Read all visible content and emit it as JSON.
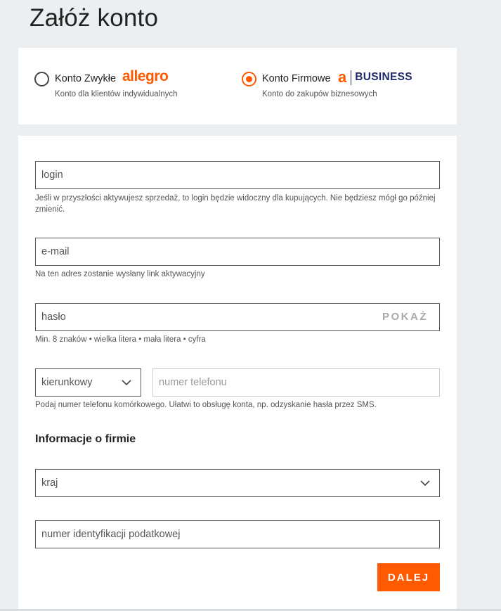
{
  "page": {
    "title": "Załóż konto"
  },
  "account_types": {
    "normal": {
      "label": "Konto Zwykłe",
      "brand": "allegro",
      "description": "Konto dla klientów indywidualnych",
      "selected": false
    },
    "business": {
      "label": "Konto Firmowe",
      "brand_mark": "a",
      "brand_text": "BUSINESS",
      "description": "Konto do zakupów biznesowych",
      "selected": true
    }
  },
  "form": {
    "login": {
      "placeholder": "login",
      "helper": "Jeśli w przyszłości aktywujesz sprzedaż, to login będzie widoczny dla kupujących. Nie będziesz mógł go później zmienić."
    },
    "email": {
      "placeholder": "e-mail",
      "helper": "Na ten adres zostanie wysłany link aktywacyjny"
    },
    "password": {
      "placeholder": "hasło",
      "show_label": "POKAŻ",
      "helper": "Min. 8 znaków • wielka litera • mała litera • cyfra"
    },
    "phone": {
      "prefix_placeholder": "kierunkowy",
      "number_placeholder": "numer telefonu",
      "helper": "Podaj numer telefonu komórkowego. Ułatwi to obsługę konta, np. odzyskanie hasła przez SMS."
    },
    "company_section_title": "Informacje o firmie",
    "country": {
      "placeholder": "kraj"
    },
    "tax_id": {
      "placeholder": "numer identyfikacji podatkowej"
    },
    "submit_label": "DALEJ"
  },
  "colors": {
    "accent": "#ff5a00",
    "business_navy": "#1f2a6b",
    "background": "#eceff1"
  }
}
